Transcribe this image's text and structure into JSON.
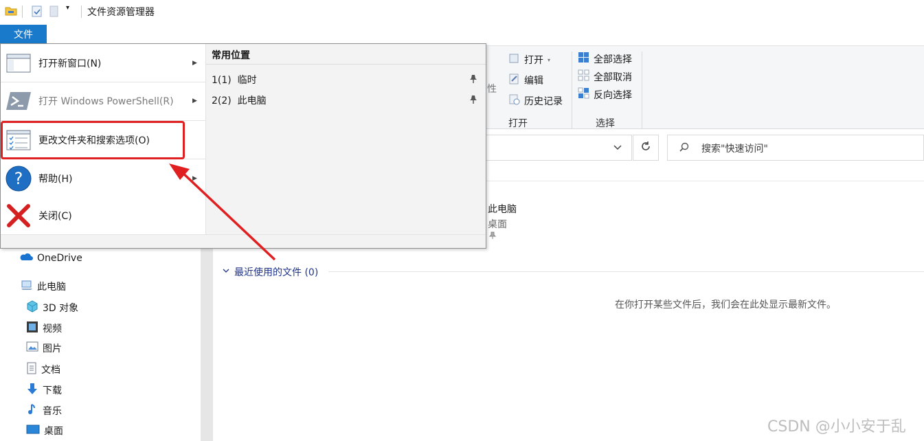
{
  "window": {
    "title": "文件资源管理器"
  },
  "file_tab": {
    "label": "文件"
  },
  "file_menu": {
    "items": [
      {
        "label": "打开新窗口(N)",
        "has_submenu": true
      },
      {
        "label": "打开 Windows PowerShell(R)",
        "has_submenu": true
      },
      {
        "label": "更改文件夹和搜索选项(O)",
        "has_submenu": false
      },
      {
        "label": "帮助(H)",
        "has_submenu": true
      },
      {
        "label": "关闭(C)",
        "has_submenu": false
      }
    ],
    "frequent_places_title": "常用位置",
    "frequent_places": [
      {
        "label": "1(1)  临时"
      },
      {
        "label": "2(2)  此电脑"
      }
    ]
  },
  "ribbon": {
    "open_group": {
      "items": [
        "打开",
        "编辑",
        "历史记录"
      ],
      "label": "打开",
      "partial": "性"
    },
    "select_group": {
      "items": [
        "全部选择",
        "全部取消",
        "反向选择"
      ],
      "label": "选择"
    }
  },
  "search": {
    "placeholder": "搜索\"快速访问\""
  },
  "nav": {
    "items": [
      "OneDrive",
      "此电脑",
      "3D 对象",
      "视频",
      "图片",
      "文档",
      "下载",
      "音乐",
      "桌面"
    ]
  },
  "content": {
    "pinned_item": {
      "name": "此电脑",
      "location": "桌面"
    },
    "recent_header": "最近使用的文件 (0)",
    "empty_message": "在你打开某些文件后，我们会在此处显示最新文件。"
  },
  "watermark": "CSDN @小小安于乱",
  "colors": {
    "accent": "#1979ca",
    "highlight": "#e02020"
  }
}
